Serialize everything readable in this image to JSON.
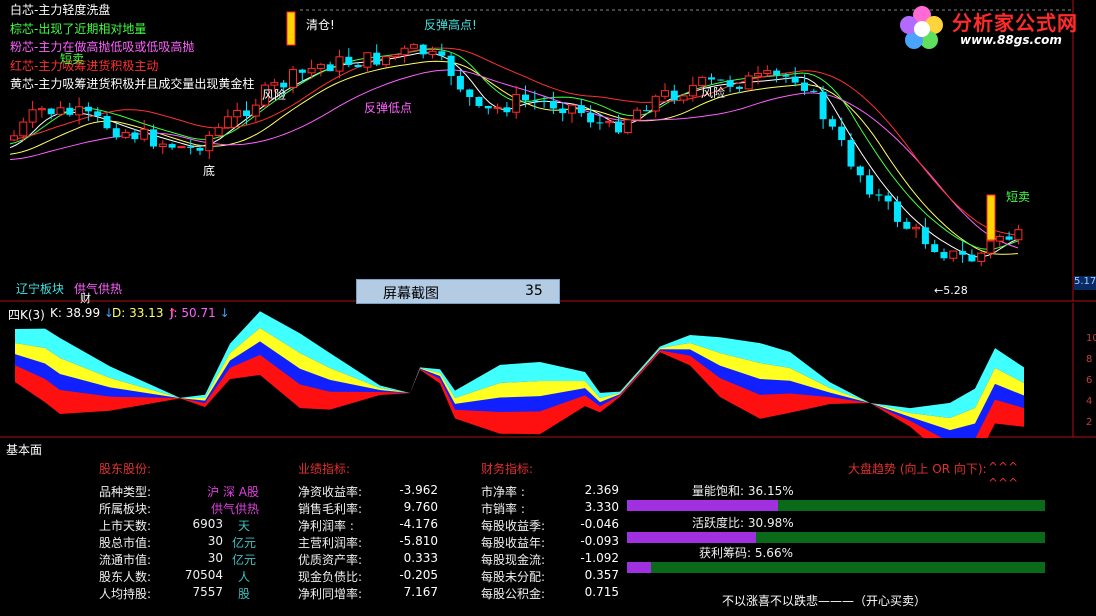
{
  "main_chart": {
    "legend": [
      {
        "text": "白芯-主力轻度洗盘",
        "color": "#ffffff"
      },
      {
        "text": "棕芯-出现了近期相对地量",
        "color": "#40ff40"
      },
      {
        "text": "粉芯-主力在做高抛低吸或低吸高抛",
        "color": "#ff60ff"
      },
      {
        "text": "红芯-主力吸筹进货积极主动",
        "color": "#ff3030"
      },
      {
        "text": "黄芯-主力吸筹进货积极并且成交量出现黄金柱",
        "color": "#ffffff"
      }
    ],
    "annotations": {
      "qingcang": "清仓!",
      "fantan_gaodian": "反弹高点!",
      "duanmai_left": "短卖",
      "fengxian_1": "风险",
      "fengxian_2": "风险",
      "fantan_didian": "反弹低点",
      "di": "底",
      "duanmai_right": "短卖",
      "low_value": "←5.28",
      "sector": "辽宁板块",
      "concept": "供气供热",
      "cai": "财"
    },
    "screenshot_label": "屏幕截图",
    "screenshot_number": "35",
    "right_value": "5.17",
    "colors": {
      "up": "#ff2a2a",
      "down": "#00e5ff",
      "ma_white": "#ffffff",
      "ma_yellow": "#ffff66",
      "ma_green": "#40ff40",
      "ma_red": "#ff3030",
      "ma_pink": "#ff60ff"
    }
  },
  "kdj": {
    "title": "四K(3)",
    "k_label": "K: 38.99",
    "d_label": "D: 33.13",
    "j_label": "J: 50.71",
    "yticks": [
      "10",
      "8",
      "6",
      "4",
      "2"
    ]
  },
  "fundamentals": {
    "panel_title": "基本面",
    "shareholder": {
      "title": "股东股份:",
      "rows": [
        {
          "label": "品种类型:",
          "value": "沪 深 A股",
          "unit": ""
        },
        {
          "label": "所属板块:",
          "value": "供气供热",
          "unit": ""
        },
        {
          "label": "上市天数:",
          "value": "6903",
          "unit": "天"
        },
        {
          "label": "股总市值:",
          "value": "30",
          "unit": "亿元"
        },
        {
          "label": "流通市值:",
          "value": "30",
          "unit": "亿元"
        },
        {
          "label": "股东人数:",
          "value": "70504",
          "unit": "人"
        },
        {
          "label": "人均持股:",
          "value": "7557",
          "unit": "股"
        }
      ]
    },
    "performance": {
      "title": "业绩指标:",
      "rows": [
        {
          "label": "净资收益率:",
          "value": "-3.962"
        },
        {
          "label": "销售毛利率:",
          "value": "9.760"
        },
        {
          "label": "净利润率  :",
          "value": "-4.176"
        },
        {
          "label": "主营利润率:",
          "value": "-5.810"
        },
        {
          "label": "优质资产率:",
          "value": "0.333"
        },
        {
          "label": "现金负债比:",
          "value": "-0.205"
        },
        {
          "label": "净利同增率:",
          "value": "7.167"
        }
      ]
    },
    "financial": {
      "title": "财务指标:",
      "rows": [
        {
          "label": "市净率      :",
          "value": "2.369"
        },
        {
          "label": "市销率      :",
          "value": "3.330"
        },
        {
          "label": "每股收益季:",
          "value": "-0.046"
        },
        {
          "label": "每股收益年:",
          "value": "-0.093"
        },
        {
          "label": "每股现金流:",
          "value": "-1.092"
        },
        {
          "label": "每股未分配:",
          "value": "0.357"
        },
        {
          "label": "每股公积金:",
          "value": "0.715"
        }
      ]
    },
    "market": {
      "title": "大盘趋势 (向上 OR 向下):",
      "arrows_1": "^^^",
      "arrows_2": "^^^",
      "bars": [
        {
          "label": "量能饱和:  36.15%",
          "fraction": 0.3615
        },
        {
          "label": "活跃度比:  30.98%",
          "fraction": 0.3098
        },
        {
          "label": "获利筹码:  5.66%",
          "fraction": 0.0566
        }
      ],
      "motto": "不以涨喜不以跌悲———（开心买卖）"
    }
  },
  "logo": {
    "title": "分析家公式网",
    "url": "www.88gs.com"
  }
}
